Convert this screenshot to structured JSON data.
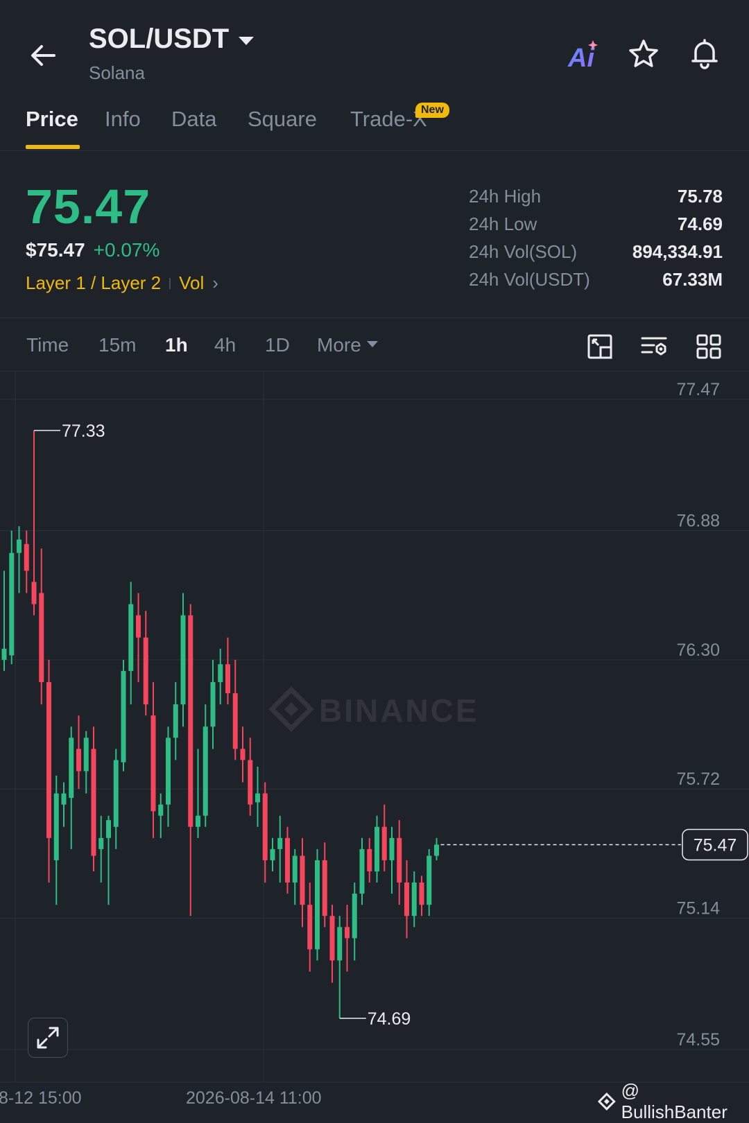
{
  "header": {
    "pair": "SOL/USDT",
    "name": "Solana",
    "icons": [
      "back-arrow-icon",
      "ai-icon",
      "star-icon",
      "bell-icon"
    ]
  },
  "tabs": [
    {
      "label": "Price",
      "active": true
    },
    {
      "label": "Info"
    },
    {
      "label": "Data"
    },
    {
      "label": "Square"
    },
    {
      "label": "Trade-X",
      "badge": "New"
    }
  ],
  "price": {
    "last": "75.47",
    "usd": "$75.47",
    "change": "+0.07%",
    "tag_category": "Layer 1 / Layer 2",
    "tag_vol": "Vol"
  },
  "stats": [
    {
      "label": "24h High",
      "value": "75.78"
    },
    {
      "label": "24h Low",
      "value": "74.69"
    },
    {
      "label": "24h Vol(SOL)",
      "value": "894,334.91"
    },
    {
      "label": "24h Vol(USDT)",
      "value": "67.33M"
    }
  ],
  "intervals": {
    "items": [
      "Time",
      "15m",
      "1h",
      "4h",
      "1D"
    ],
    "active": "1h",
    "more": "More"
  },
  "colors": {
    "up": "#2ebd85",
    "down": "#f6465d",
    "accent": "#f0b90b",
    "background": "#1e2329"
  },
  "chart_data": {
    "type": "candlestick",
    "y_ticks": [
      "77.47",
      "76.88",
      "76.30",
      "75.72",
      "75.14",
      "74.55"
    ],
    "x_ticks": [
      "8-12 15:00",
      "2026-08-14 11:00"
    ],
    "ylim": [
      74.55,
      77.47
    ],
    "last_price_label": "75.47",
    "high_marker": "77.33",
    "low_marker": "74.69",
    "watermark": "BINANCE",
    "grid": true,
    "candles": [
      {
        "o": 76.3,
        "h": 76.7,
        "l": 76.25,
        "c": 76.35
      },
      {
        "o": 76.32,
        "h": 76.88,
        "l": 76.28,
        "c": 76.78
      },
      {
        "o": 76.78,
        "h": 76.9,
        "l": 76.6,
        "c": 76.84
      },
      {
        "o": 76.82,
        "h": 76.88,
        "l": 76.6,
        "c": 76.7
      },
      {
        "o": 76.65,
        "h": 77.33,
        "l": 76.5,
        "c": 76.55
      },
      {
        "o": 76.6,
        "h": 76.8,
        "l": 76.1,
        "c": 76.2
      },
      {
        "o": 76.2,
        "h": 76.3,
        "l": 75.3,
        "c": 75.5
      },
      {
        "o": 75.4,
        "h": 75.78,
        "l": 75.2,
        "c": 75.7
      },
      {
        "o": 75.65,
        "h": 75.75,
        "l": 75.55,
        "c": 75.7
      },
      {
        "o": 75.68,
        "h": 76.0,
        "l": 75.45,
        "c": 75.95
      },
      {
        "o": 75.9,
        "h": 76.05,
        "l": 75.72,
        "c": 75.8
      },
      {
        "o": 75.8,
        "h": 75.98,
        "l": 75.7,
        "c": 75.95
      },
      {
        "o": 75.9,
        "h": 76.0,
        "l": 75.35,
        "c": 75.42
      },
      {
        "o": 75.45,
        "h": 75.6,
        "l": 75.3,
        "c": 75.5
      },
      {
        "o": 75.5,
        "h": 75.6,
        "l": 75.2,
        "c": 75.58
      },
      {
        "o": 75.55,
        "h": 75.9,
        "l": 75.45,
        "c": 75.85
      },
      {
        "o": 75.84,
        "h": 76.3,
        "l": 75.8,
        "c": 76.25
      },
      {
        "o": 76.25,
        "h": 76.65,
        "l": 76.1,
        "c": 76.55
      },
      {
        "o": 76.5,
        "h": 76.6,
        "l": 76.2,
        "c": 76.4
      },
      {
        "o": 76.4,
        "h": 76.52,
        "l": 76.05,
        "c": 76.1
      },
      {
        "o": 76.05,
        "h": 76.2,
        "l": 75.5,
        "c": 75.62
      },
      {
        "o": 75.6,
        "h": 75.7,
        "l": 75.5,
        "c": 75.65
      },
      {
        "o": 75.65,
        "h": 76.0,
        "l": 75.55,
        "c": 75.95
      },
      {
        "o": 75.95,
        "h": 76.2,
        "l": 75.85,
        "c": 76.1
      },
      {
        "o": 76.1,
        "h": 76.6,
        "l": 76.0,
        "c": 76.5
      },
      {
        "o": 76.5,
        "h": 76.55,
        "l": 75.15,
        "c": 75.55
      },
      {
        "o": 75.55,
        "h": 75.9,
        "l": 75.5,
        "c": 75.6
      },
      {
        "o": 75.6,
        "h": 76.1,
        "l": 75.55,
        "c": 76.0
      },
      {
        "o": 76.0,
        "h": 76.3,
        "l": 75.9,
        "c": 76.2
      },
      {
        "o": 76.2,
        "h": 76.35,
        "l": 76.1,
        "c": 76.28
      },
      {
        "o": 76.28,
        "h": 76.4,
        "l": 76.1,
        "c": 76.15
      },
      {
        "o": 76.15,
        "h": 76.3,
        "l": 75.85,
        "c": 75.9
      },
      {
        "o": 75.9,
        "h": 76.0,
        "l": 75.75,
        "c": 75.85
      },
      {
        "o": 75.85,
        "h": 75.95,
        "l": 75.6,
        "c": 75.65
      },
      {
        "o": 75.66,
        "h": 75.82,
        "l": 75.55,
        "c": 75.7
      },
      {
        "o": 75.7,
        "h": 75.75,
        "l": 75.3,
        "c": 75.4
      },
      {
        "o": 75.4,
        "h": 75.5,
        "l": 75.35,
        "c": 75.45
      },
      {
        "o": 75.45,
        "h": 75.6,
        "l": 75.3,
        "c": 75.5
      },
      {
        "o": 75.5,
        "h": 75.55,
        "l": 75.25,
        "c": 75.3
      },
      {
        "o": 75.3,
        "h": 75.45,
        "l": 75.2,
        "c": 75.42
      },
      {
        "o": 75.42,
        "h": 75.5,
        "l": 75.1,
        "c": 75.2
      },
      {
        "o": 75.2,
        "h": 75.3,
        "l": 74.9,
        "c": 75.0
      },
      {
        "o": 75.0,
        "h": 75.45,
        "l": 74.95,
        "c": 75.4
      },
      {
        "o": 75.4,
        "h": 75.48,
        "l": 75.1,
        "c": 75.15
      },
      {
        "o": 75.15,
        "h": 75.2,
        "l": 74.85,
        "c": 74.95
      },
      {
        "o": 74.95,
        "h": 75.15,
        "l": 74.69,
        "c": 75.1
      },
      {
        "o": 75.1,
        "h": 75.2,
        "l": 74.9,
        "c": 75.05
      },
      {
        "o": 75.05,
        "h": 75.3,
        "l": 74.95,
        "c": 75.25
      },
      {
        "o": 75.25,
        "h": 75.5,
        "l": 75.2,
        "c": 75.45
      },
      {
        "o": 75.45,
        "h": 75.5,
        "l": 75.3,
        "c": 75.35
      },
      {
        "o": 75.35,
        "h": 75.6,
        "l": 75.3,
        "c": 75.55
      },
      {
        "o": 75.55,
        "h": 75.65,
        "l": 75.35,
        "c": 75.4
      },
      {
        "o": 75.4,
        "h": 75.55,
        "l": 75.25,
        "c": 75.5
      },
      {
        "o": 75.5,
        "h": 75.58,
        "l": 75.2,
        "c": 75.3
      },
      {
        "o": 75.3,
        "h": 75.4,
        "l": 75.05,
        "c": 75.15
      },
      {
        "o": 75.15,
        "h": 75.35,
        "l": 75.1,
        "c": 75.3
      },
      {
        "o": 75.3,
        "h": 75.33,
        "l": 75.15,
        "c": 75.2
      },
      {
        "o": 75.2,
        "h": 75.45,
        "l": 75.15,
        "c": 75.42
      },
      {
        "o": 75.42,
        "h": 75.5,
        "l": 75.4,
        "c": 75.47
      }
    ]
  },
  "footer": {
    "watermark": "@ BullishBanter"
  }
}
